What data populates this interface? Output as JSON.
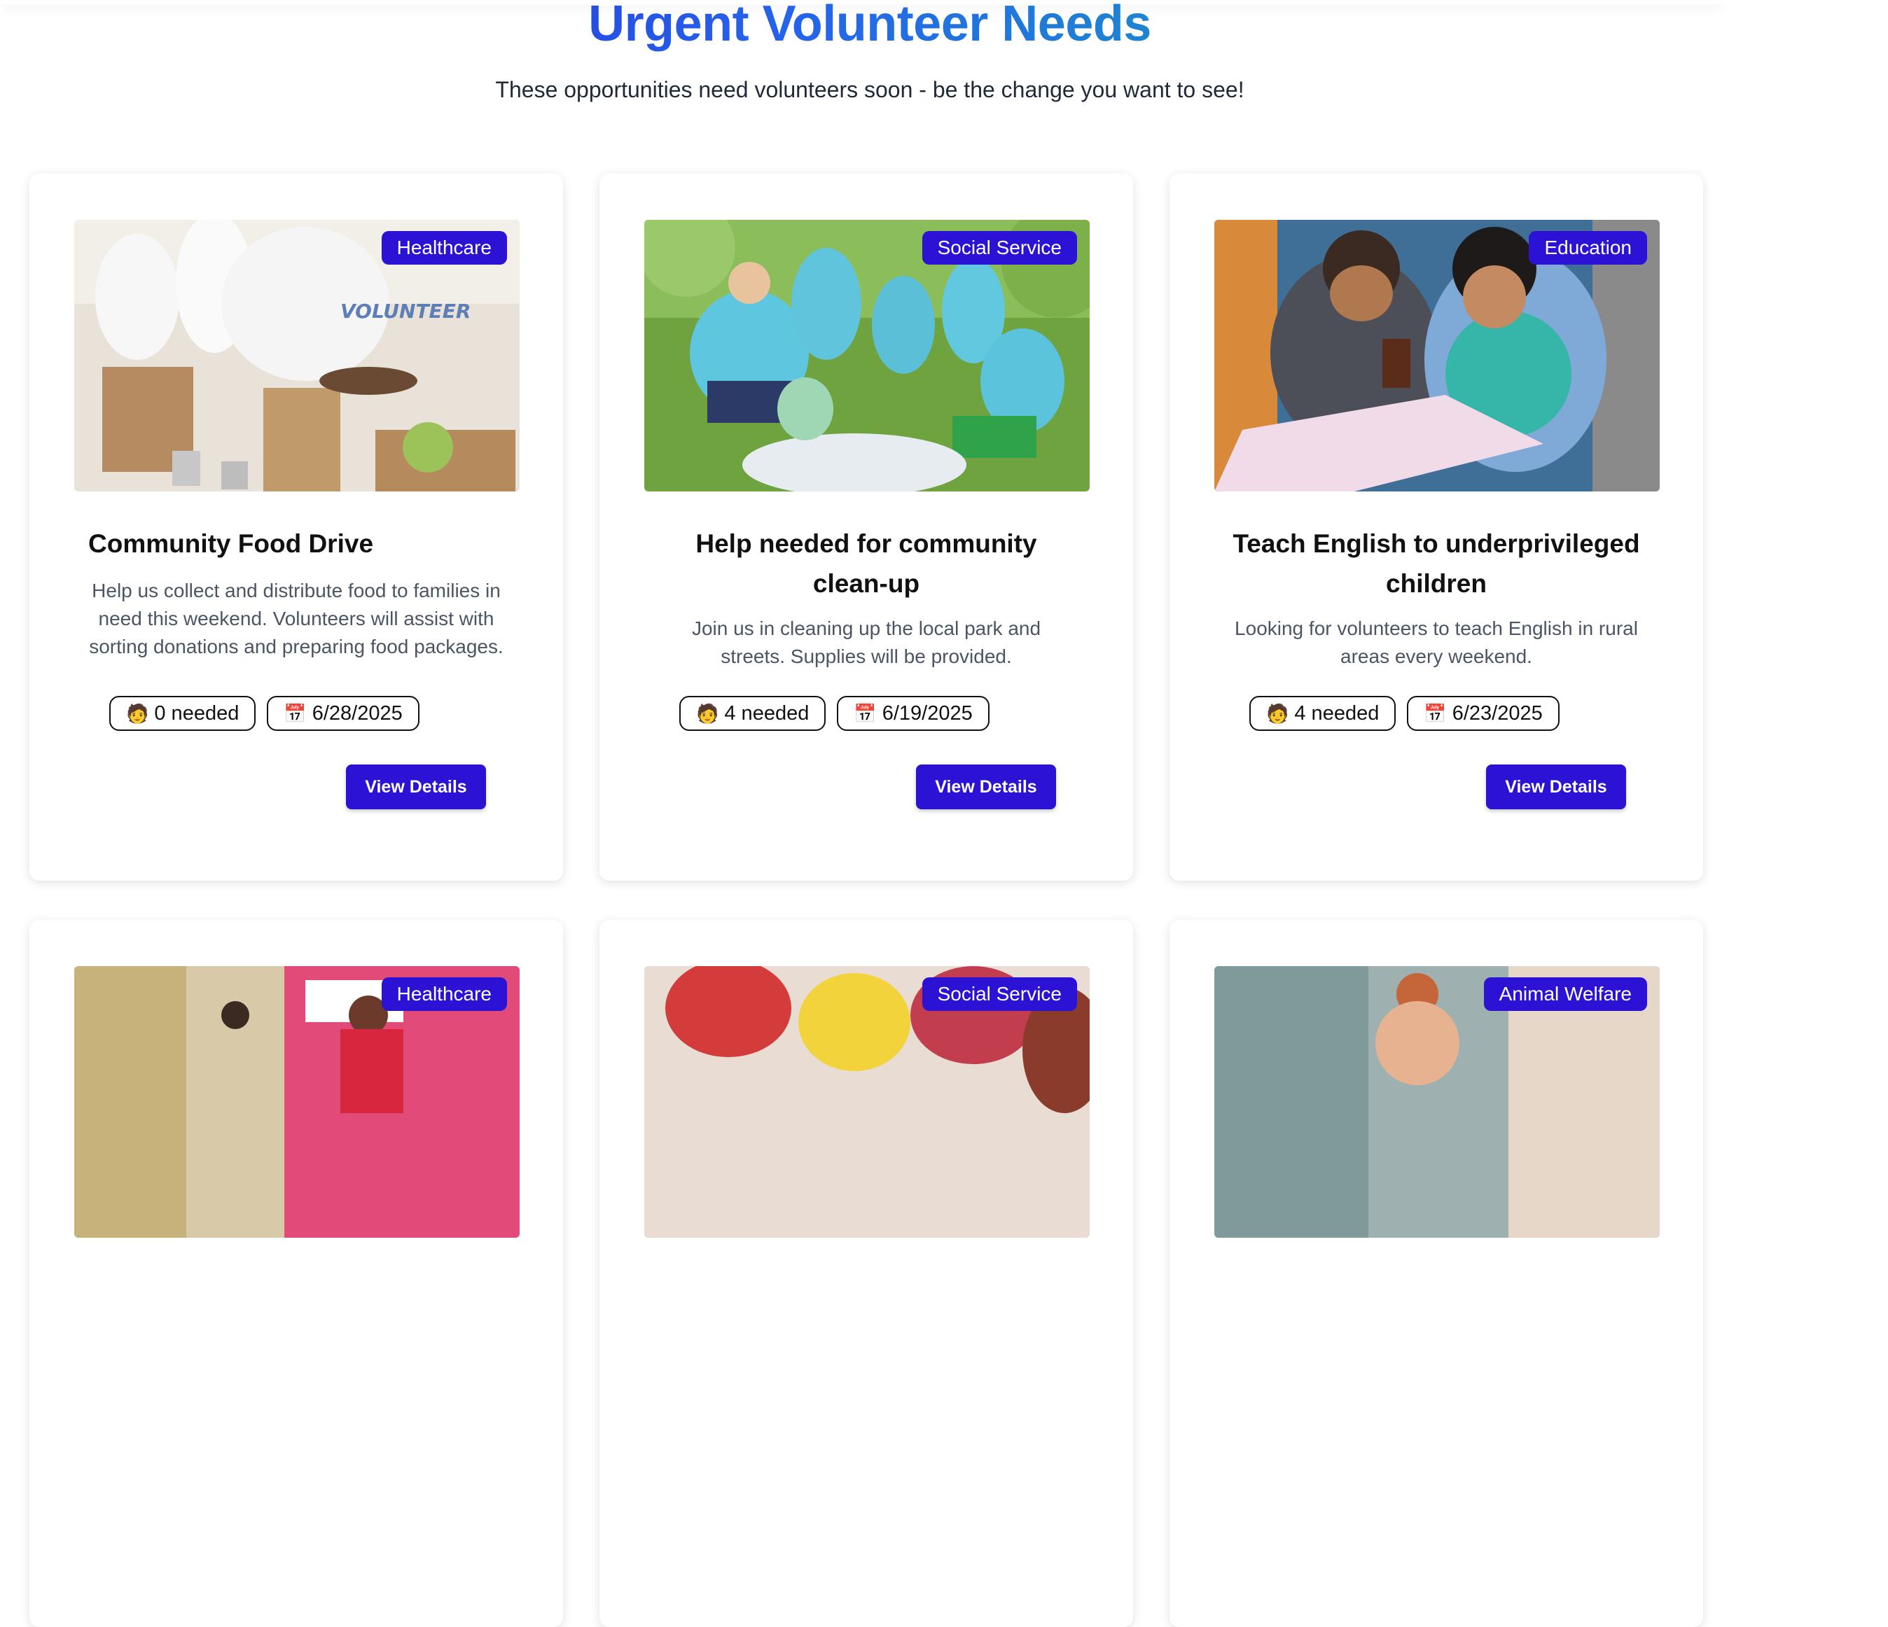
{
  "header": {
    "title": "Urgent Volunteer Needs",
    "subtitle": "These opportunities need volunteers soon - be the change you want to see!"
  },
  "colors": {
    "accent": "#2b12d4",
    "title_gradient": [
      "#2b15cf",
      "#2563eb",
      "#14b8a6"
    ]
  },
  "cards": [
    {
      "category": "Healthcare",
      "title": "Community Food Drive",
      "description": "Help us collect and distribute food to families in need this weekend. Volunteers will assist with sorting donations and preparing food packages.",
      "needed": "0 needed",
      "date": "6/28/2025",
      "button": "View Details",
      "image": "volunteers-packing-food-photo"
    },
    {
      "category": "Social Service",
      "title": "Help needed for community clean-up",
      "description": "Join us in cleaning up the local park and streets. Supplies will be provided.",
      "needed": "4 needed",
      "date": "6/19/2025",
      "button": "View Details",
      "image": "park-cleanup-photo"
    },
    {
      "category": "Education",
      "title": "Teach English to underprivileged children",
      "description": "Looking for volunteers to teach English in rural areas every weekend.",
      "needed": "4 needed",
      "date": "6/23/2025",
      "button": "View Details",
      "image": "tutoring-children-photo"
    },
    {
      "category": "Healthcare",
      "image": "health-camp-photo"
    },
    {
      "category": "Social Service",
      "image": "community-event-photo"
    },
    {
      "category": "Animal Welfare",
      "image": "animal-welfare-photo"
    }
  ],
  "icons": {
    "needed": "person-emoji-icon",
    "date": "calendar-icon"
  }
}
